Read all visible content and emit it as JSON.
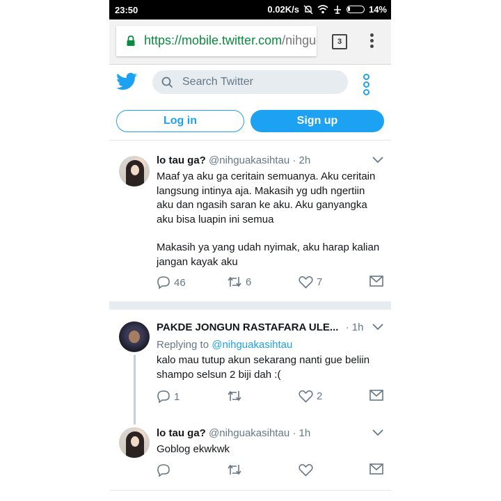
{
  "status_bar": {
    "time": "23:50",
    "speed": "0.02K/s",
    "battery": "14%"
  },
  "browser": {
    "url_scheme": "https://",
    "url_host": "mobile.twitter.com",
    "url_rest": "/nihguakasihtau",
    "tab_count": "3"
  },
  "header": {
    "search_placeholder": "Search Twitter",
    "login_label": "Log in",
    "signup_label": "Sign up"
  },
  "tweets": [
    {
      "name": "lo tau ga?",
      "handle": "@nihguakasihtau",
      "time": "· 2h",
      "text_p1": "Maaf ya aku ga ceritain semuanya. Aku ceritain langsung intinya aja. Makasih yg udh ngertiin aku dan ngasih saran ke aku. Aku ganyangka aku bisa luapin ini semua",
      "text_p2": "Makasih ya yang udah nyimak, aku harap kalian jangan kayak aku",
      "replies": "46",
      "retweets": "6",
      "likes": "7"
    },
    {
      "name": "PAKDE JONGUN RASTAFARA ULE...",
      "time": "· 1h",
      "replying_prefix": "Replying to",
      "replying_handle": "@nihguakasihtau",
      "text": "kalo mau tutup akun sekarang nanti gue beliin shampo selsun 2 biji dah :(",
      "replies": "1",
      "retweets": "",
      "likes": "2"
    },
    {
      "name": "lo tau ga?",
      "handle": "@nihguakasihtau",
      "time": "· 1h",
      "text": "Goblog ekwkwk",
      "replies": "",
      "retweets": "",
      "likes": ""
    }
  ],
  "colors": {
    "accent": "#1da1f2",
    "secure": "#0a8a3d",
    "muted": "#657786",
    "separator": "#e6ecf0"
  },
  "icons": [
    "lock-icon",
    "twitter-bird-icon",
    "search-icon",
    "more-options-icon",
    "chevron-down-icon",
    "reply-icon",
    "retweet-icon",
    "like-icon",
    "message-icon"
  ]
}
